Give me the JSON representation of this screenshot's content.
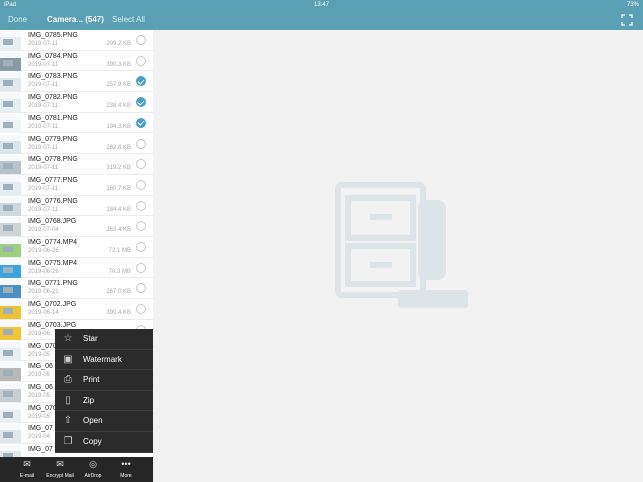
{
  "status": {
    "device": "iPad",
    "time": "13:47",
    "battery": "73%"
  },
  "nav": {
    "done": "Done",
    "title": "Camera... (547)",
    "select_all": "Select All"
  },
  "files": [
    {
      "name": "IMG_0785.PNG",
      "date": "2019-07-11",
      "size": "209.2 KB",
      "selected": false
    },
    {
      "name": "IMG_0784.PNG",
      "date": "2019-07-11",
      "size": "390.3 KB",
      "selected": false
    },
    {
      "name": "IMG_0783.PNG",
      "date": "2019-07-11",
      "size": "257.9 KB",
      "selected": true
    },
    {
      "name": "IMG_0782.PNG",
      "date": "2019-07-11",
      "size": "238.4 KB",
      "selected": true
    },
    {
      "name": "IMG_0781.PNG",
      "date": "2019-07-11",
      "size": "194.3 KB",
      "selected": true
    },
    {
      "name": "IMG_0779.PNG",
      "date": "2019-07-11",
      "size": "262.8 KB",
      "selected": false
    },
    {
      "name": "IMG_0778.PNG",
      "date": "2019-07-11",
      "size": "319.2 KB",
      "selected": false
    },
    {
      "name": "IMG_0777.PNG",
      "date": "2019-07-11",
      "size": "160.7 KB",
      "selected": false
    },
    {
      "name": "IMG_0776.PNG",
      "date": "2019-07-11",
      "size": "184.4 KB",
      "selected": false
    },
    {
      "name": "IMG_0768.JPG",
      "date": "2019-07-04",
      "size": "263.4 KB",
      "selected": false
    },
    {
      "name": "IMG_0774.MP4",
      "date": "2019-06-26",
      "size": "72.1 MB",
      "selected": false
    },
    {
      "name": "IMG_0775.MP4",
      "date": "2019-06-26",
      "size": "70.3 MB",
      "selected": false
    },
    {
      "name": "IMG_0771.PNG",
      "date": "2019-06-21",
      "size": "267.0 KB",
      "selected": false
    },
    {
      "name": "IMG_0702.JPG",
      "date": "2019-06-14",
      "size": "390.4 KB",
      "selected": false
    },
    {
      "name": "IMG_0703.JPG",
      "date": "2019-06",
      "size": "",
      "selected": false
    },
    {
      "name": "IMG_070",
      "date": "2019-05",
      "size": "",
      "selected": false
    },
    {
      "name": "IMG_06",
      "date": "2019-05",
      "size": "",
      "selected": false
    },
    {
      "name": "IMG_06",
      "date": "2019-05",
      "size": "",
      "selected": false
    },
    {
      "name": "IMG_070",
      "date": "2019-05",
      "size": "",
      "selected": false
    },
    {
      "name": "IMG_07",
      "date": "2019-04",
      "size": "",
      "selected": false
    },
    {
      "name": "IMG_07",
      "date": "",
      "size": "",
      "selected": false
    }
  ],
  "menu": [
    {
      "label": "Star",
      "icon": "star-icon"
    },
    {
      "label": "Watermark",
      "icon": "watermark-icon"
    },
    {
      "label": "Print",
      "icon": "print-icon"
    },
    {
      "label": "Zip",
      "icon": "zip-icon"
    },
    {
      "label": "Open",
      "icon": "open-icon"
    },
    {
      "label": "Copy",
      "icon": "copy-icon"
    }
  ],
  "toolbar": [
    {
      "label": "E-mail",
      "icon": "email-icon"
    },
    {
      "label": "Encrypt Mail",
      "icon": "encrypt-mail-icon"
    },
    {
      "label": "AirDrop",
      "icon": "airdrop-icon"
    },
    {
      "label": "More",
      "icon": "more-icon"
    }
  ],
  "colors": {
    "accent": "#5b9fb4",
    "check": "#4a9ec5",
    "menu_bg": "#2b2b2b"
  }
}
